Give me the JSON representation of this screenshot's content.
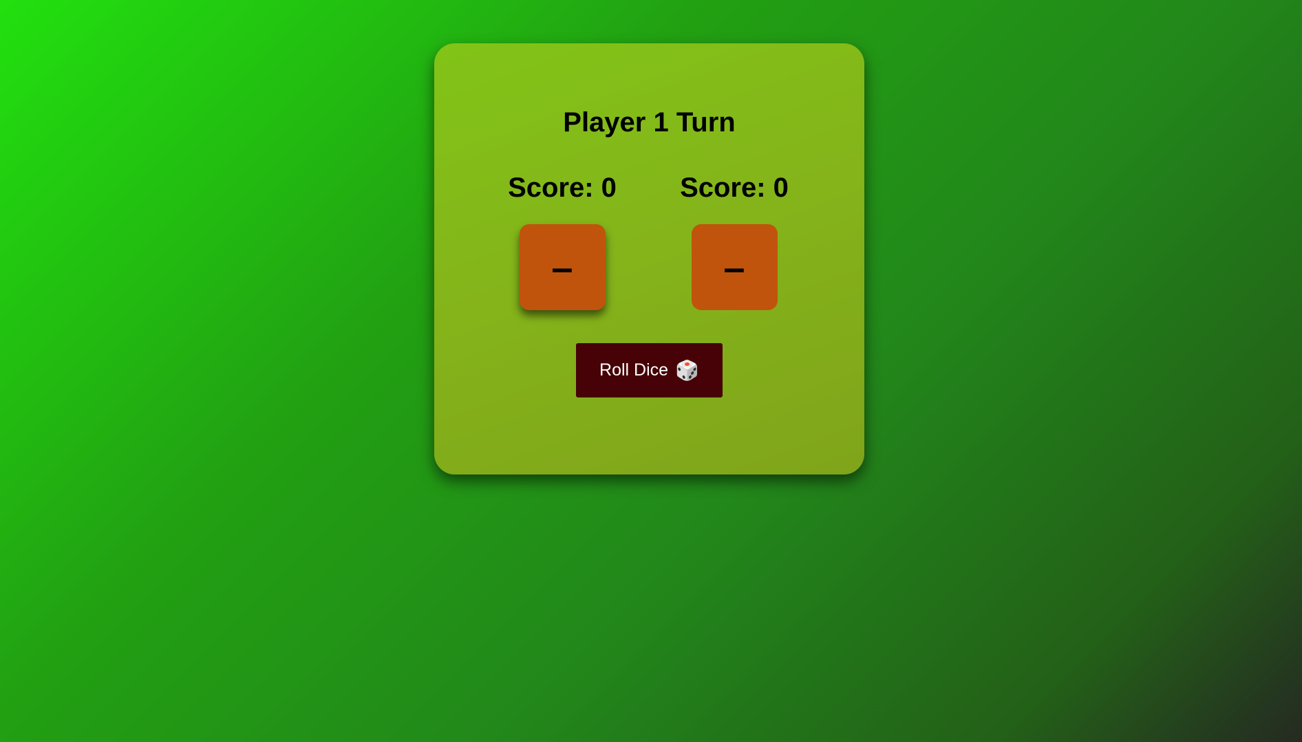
{
  "game": {
    "turn_label": "Player 1 Turn",
    "players": [
      {
        "score_label": "Score: 0",
        "die_face": "–",
        "active": true
      },
      {
        "score_label": "Score: 0",
        "die_face": "–",
        "active": false
      }
    ],
    "roll_button": {
      "label": "Roll Dice",
      "icon": "dice-icon",
      "icon_glyph": "🎲"
    }
  },
  "colors": {
    "card_background": "#84b31a",
    "die_background": "#c1540d",
    "button_background": "#460206",
    "button_text": "#ffffff"
  }
}
